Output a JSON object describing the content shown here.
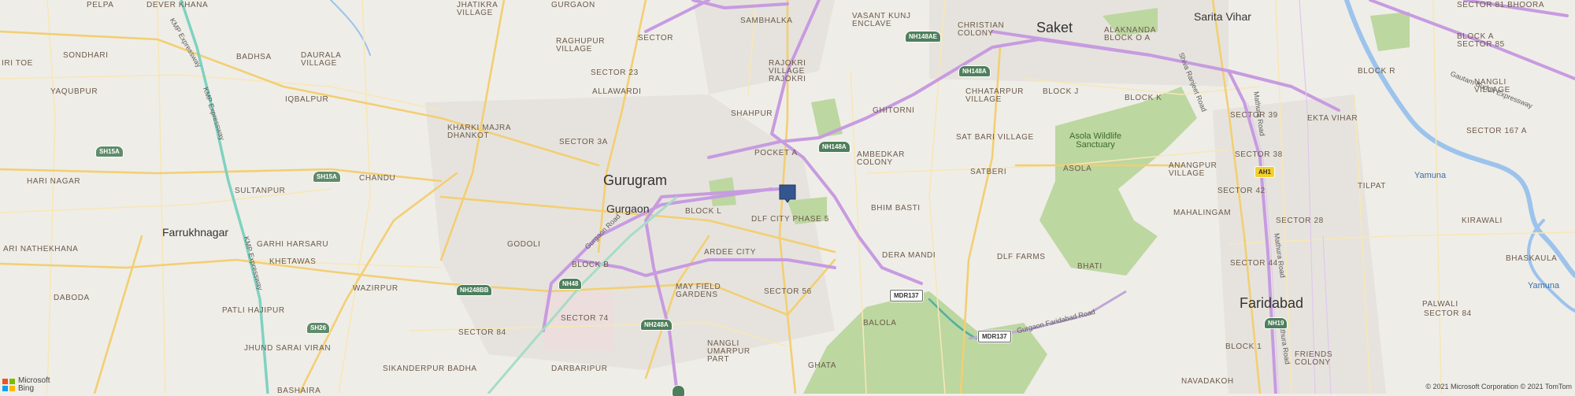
{
  "map": {
    "cities": {
      "gurugram": "Gurugram",
      "gurgaon": "Gurgaon",
      "saket": "Saket",
      "sarita_vihar": "Sarita Vihar",
      "faridabad": "Faridabad",
      "farrukhnagar": "Farrukhnagar"
    },
    "places": {
      "pelpa": "PELPA",
      "dever_khana": "DEVER KHANA",
      "jhatikra_village": "JHATIKRA VILLAGE",
      "gurgaon_top": "GURGAON",
      "sambhalka": "SAMBHALKA",
      "vasant_kunj_enclave": "VASANT KUNJ ENCLAVE",
      "christian_colony": "CHRISTIAN COLONY",
      "alaknanda_block_o_a": "ALAKNANDA BLOCK O A",
      "sector_81_bhoora": "SECTOR 81 BHOORA",
      "sondhari": "SONDHARI",
      "badhsa": "BADHSA",
      "daurala_village": "DAURALA VILLAGE",
      "raghupur_village": "RAGHUPUR VILLAGE",
      "sector_top": "SECTOR",
      "block_a_sector_85": "BLOCK A SECTOR 85",
      "iri_toe": "IRI TOE",
      "sector_23": "SECTOR 23",
      "rajokri_village_rajokri": "RAJOKRI VILLAGE RAJOKRI",
      "chhatarpur_village": "CHHATARPUR VILLAGE",
      "block_j": "BLOCK J",
      "block_r": "BLOCK R",
      "iqbalpur": "IQBALPUR",
      "allawardi": "ALLAWARDI",
      "nangli_village": "NANGLI VILLAGE",
      "yaqubpur": "YAQUBPUR",
      "ghitorni": "GHITORNI",
      "block_k": "BLOCK K",
      "shahpur": "SHAHPUR",
      "kharki_majra_dhankot": "KHARKI MAJRA DHANKOT",
      "sector_39": "SECTOR 39",
      "ekta_vihar": "EKTA VIHAR",
      "sector_167_a": "SECTOR 167 A",
      "sat_bari_village": "SAT BARI VILLAGE",
      "sector_3a": "SECTOR 3A",
      "pocket_a": "POCKET A",
      "ambedkar_colony": "AMBEDKAR COLONY",
      "sector_38": "SECTOR 38",
      "hari_nagar": "HARI NAGAR",
      "chandu": "CHANDU",
      "satberi": "SATBERI",
      "anangpur_village": "ANANGPUR VILLAGE",
      "asola": "ASOLA",
      "tilpat": "TILPAT",
      "sultanpur": "SULTANPUR",
      "sector_42": "SECTOR 42",
      "block_l": "BLOCK L",
      "bhim_basti": "BHIM BASTI",
      "mahalingam": "MAHALINGAM",
      "dlf_city_phase_5": "DLF CITY PHASE 5",
      "sector_28": "SECTOR 28",
      "kirawali": "KIRAWALI",
      "ari_nathekhana": "ARI NATHEKHANA",
      "godoli": "GODOLI",
      "garhi_harsaru": "GARHI HARSARU",
      "ardee_city": "ARDEE CITY",
      "khetawas": "KHETAWAS",
      "dera_mandi": "DERA MANDI",
      "dlf_farms": "DLF FARMS",
      "bhati": "BHATI",
      "sector_44": "SECTOR 44",
      "bhaskaula": "BHASKAULA",
      "block_b": "BLOCK B",
      "wazirpur": "WAZIRPUR",
      "may_field_gardens": "MAY FIELD GARDENS",
      "sector_56": "SECTOR 56",
      "daboda": "DABODA",
      "patli_hajipur": "PATLI HAJIPUR",
      "palwali": "PALWALI",
      "sector_74": "SECTOR 74",
      "sector_84_left": "SECTOR 84",
      "balola": "BALOLA",
      "sector_84_right": "SECTOR 84",
      "nangli_umarpur_part": "NANGLI UMARPUR PART",
      "jhund_sarai_viran": "JHUND SARAI VIRAN",
      "block_1": "BLOCK 1",
      "friends_colony": "FRIENDS COLONY",
      "sikanderpur_badha": "SIKANDERPUR BADHA",
      "ghata": "GHATA",
      "darbaripur": "DARBARIPUR",
      "navadakoh": "NAVADAKOH",
      "bashaira": "BASHAIRA"
    },
    "parks": {
      "asola_wildlife": "Asola Wildlife Sanctuary"
    },
    "water": {
      "yamuna_top": "Yamuna",
      "yamuna_bottom": "Yamuna"
    },
    "road_names": {
      "kmp_expressway_top": "KMP Expressway",
      "kmp_expressway_mid": "KMP Expressway",
      "kmp_expressway_low": "KMP Expressway",
      "gurgaon_road": "Gurgaon Road",
      "shiva_ranjeet_road": "Shiva Ranjeet Road",
      "mathura_road_top": "Mathura Road",
      "mathura_road_mid": "Mathura Road",
      "mathura_road_low": "Mathura Road",
      "gautam_buddh_expressway": "Gautam Buddh Expressway",
      "gurgaon_faridabad_road": "Gurgaon Faridabad Road"
    },
    "shields": {
      "nh148ae": "NH148AE",
      "nh148a_top": "NH148A",
      "nh148a_mid": "NH148A",
      "sh15a_left": "SH15A",
      "sh15a_right": "SH15A",
      "nh48": "NH48",
      "nh248bb": "NH248BB",
      "nh248a": "NH248A",
      "sh26": "SH26",
      "mdr137_a": "MDR137",
      "mdr137_b": "MDR137",
      "ah1": "AH1",
      "nh19": "NH19"
    },
    "marker": {
      "name": "location-pin",
      "color": "#34568f"
    },
    "colors": {
      "background": "#efede8",
      "expressway": "#c79be0",
      "major_road": "#f2cf72",
      "park": "#b6d49a",
      "water": "#9cc3ec"
    }
  },
  "attribution": {
    "logo_line1": "Microsoft",
    "logo_line2": "Bing",
    "copyright": "© 2021 Microsoft Corporation © 2021 TomTom"
  }
}
